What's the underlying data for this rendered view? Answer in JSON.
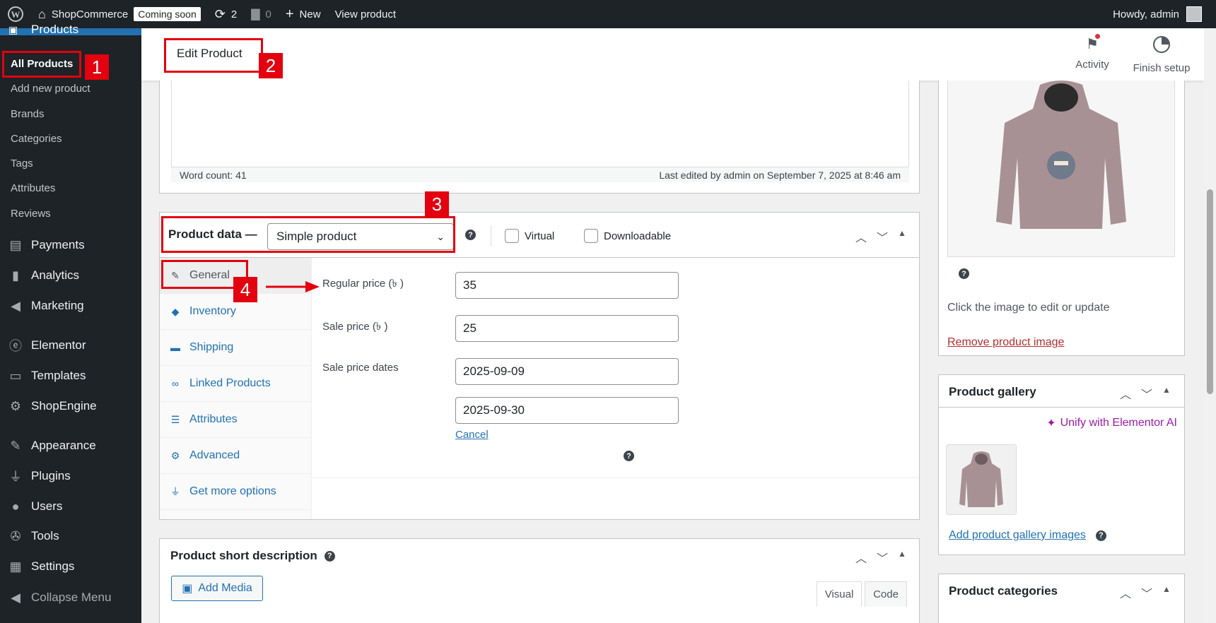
{
  "adminbar": {
    "site_name": "ShopCommerce",
    "coming_soon": "Coming soon",
    "updates_count": "2",
    "comments_count": "0",
    "new_label": "New",
    "view_product": "View product",
    "greeting": "Howdy, admin"
  },
  "sidebar": {
    "section_title": "Products",
    "sub_items": [
      {
        "label": "All Products",
        "active": true
      },
      {
        "label": "Add new product"
      },
      {
        "label": "Brands"
      },
      {
        "label": "Categories"
      },
      {
        "label": "Tags"
      },
      {
        "label": "Attributes"
      },
      {
        "label": "Reviews"
      }
    ],
    "main_items": [
      {
        "label": "Payments",
        "icon": "payments-icon"
      },
      {
        "label": "Analytics",
        "icon": "analytics-icon"
      },
      {
        "label": "Marketing",
        "icon": "megaphone-icon"
      },
      {
        "label": "Elementor",
        "icon": "elementor-icon"
      },
      {
        "label": "Templates",
        "icon": "folder-icon"
      },
      {
        "label": "ShopEngine",
        "icon": "gear-icon"
      },
      {
        "label": "Appearance",
        "icon": "brush-icon"
      },
      {
        "label": "Plugins",
        "icon": "plug-icon"
      },
      {
        "label": "Users",
        "icon": "user-icon"
      },
      {
        "label": "Tools",
        "icon": "wrench-icon"
      },
      {
        "label": "Settings",
        "icon": "settings-icon"
      },
      {
        "label": "Collapse Menu",
        "icon": "collapse-icon"
      }
    ]
  },
  "header": {
    "title": "Edit Product",
    "activity": "Activity",
    "finish_setup": "Finish setup"
  },
  "editor": {
    "word_count": "Word count: 41",
    "last_edited": "Last edited by admin on September 7, 2025 at 8:46 am"
  },
  "product_data": {
    "label": "Product data —",
    "type": "Simple product",
    "virtual": "Virtual",
    "downloadable": "Downloadable",
    "tabs": [
      {
        "label": "General",
        "icon": "wrench-icon",
        "active": true
      },
      {
        "label": "Inventory",
        "icon": "tag-icon"
      },
      {
        "label": "Shipping",
        "icon": "truck-icon"
      },
      {
        "label": "Linked Products",
        "icon": "link-icon"
      },
      {
        "label": "Attributes",
        "icon": "list-icon"
      },
      {
        "label": "Advanced",
        "icon": "gear-icon"
      },
      {
        "label": "Get more options",
        "icon": "plug-icon"
      }
    ],
    "fields": {
      "regular_price_label": "Regular price (৳ )",
      "regular_price": "35",
      "sale_price_label": "Sale price (৳ )",
      "sale_price": "25",
      "sale_dates_label": "Sale price dates",
      "sale_from": "2025-09-09",
      "sale_to": "2025-09-30",
      "cancel": "Cancel"
    }
  },
  "short_description": {
    "title": "Product short description",
    "add_media": "Add Media",
    "tab_visual": "Visual",
    "tab_code": "Code"
  },
  "product_image": {
    "tip": "Click the image to edit or update",
    "remove": "Remove product image"
  },
  "gallery": {
    "title": "Product gallery",
    "ai_link": "Unify with Elementor AI",
    "add_link": "Add product gallery images"
  },
  "categories": {
    "title": "Product categories"
  },
  "annotations": [
    "1",
    "2",
    "3",
    "4"
  ],
  "colors": {
    "adminbar_bg": "#1d2327",
    "link": "#2271b1",
    "annotation_red": "#e3000f",
    "remove_link": "#b32d2e",
    "ai_purple": "#9b1ca6"
  }
}
